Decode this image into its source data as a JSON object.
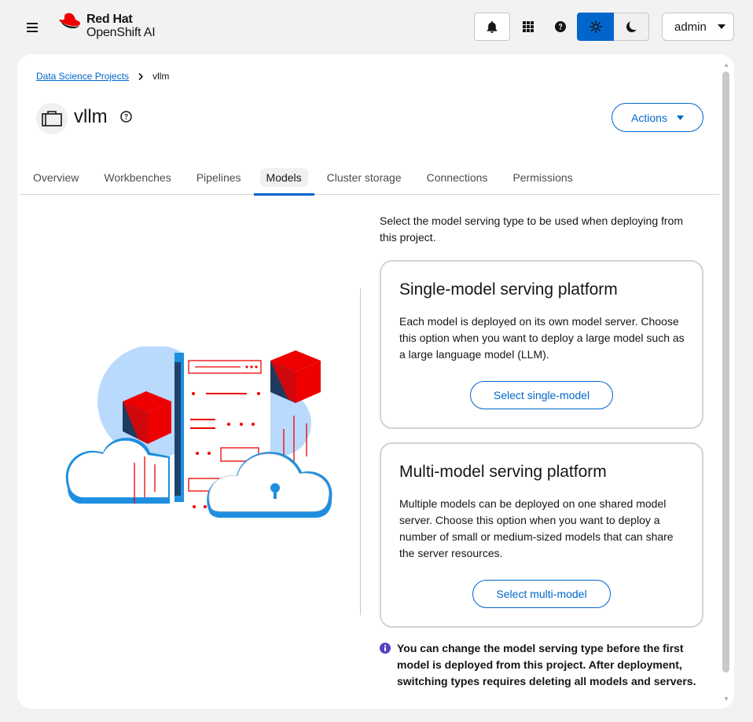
{
  "masthead": {
    "brand_line1": "Red Hat",
    "brand_line2": "OpenShift AI",
    "user_label": "admin"
  },
  "breadcrumb": {
    "parent": "Data Science Projects",
    "current": "vllm"
  },
  "project": {
    "title": "vllm",
    "actions_label": "Actions"
  },
  "tabs": [
    {
      "label": "Overview"
    },
    {
      "label": "Workbenches"
    },
    {
      "label": "Pipelines"
    },
    {
      "label": "Models"
    },
    {
      "label": "Cluster storage"
    },
    {
      "label": "Connections"
    },
    {
      "label": "Permissions"
    }
  ],
  "active_tab": "Models",
  "serving": {
    "intro": "Select the model serving type to be used when deploying from this project.",
    "single": {
      "title": "Single-model serving platform",
      "description": "Each model is deployed on its own model server. Choose this option when you want to deploy a large model such as a large language model (LLM).",
      "button": "Select single-model"
    },
    "multi": {
      "title": "Multi-model serving platform",
      "description": "Multiple models can be deployed on one shared model server. Choose this option when you want to deploy a number of small or medium-sized models that can share the server resources.",
      "button": "Select multi-model"
    },
    "note": "You can change the model serving type before the first model is deployed from this project. After deployment, switching types requires deleting all models and servers."
  },
  "colors": {
    "brand_red": "#ee0000",
    "primary_blue": "#0066cc",
    "info_purple": "#5e40be"
  },
  "icons": [
    "hamburger-icon",
    "redhat-logo",
    "bell-icon",
    "app-grid-icon",
    "question-circle-icon",
    "sun-icon",
    "moon-icon",
    "caret-down-icon",
    "chevron-right-icon",
    "project-folder-icon",
    "info-circle-icon"
  ]
}
